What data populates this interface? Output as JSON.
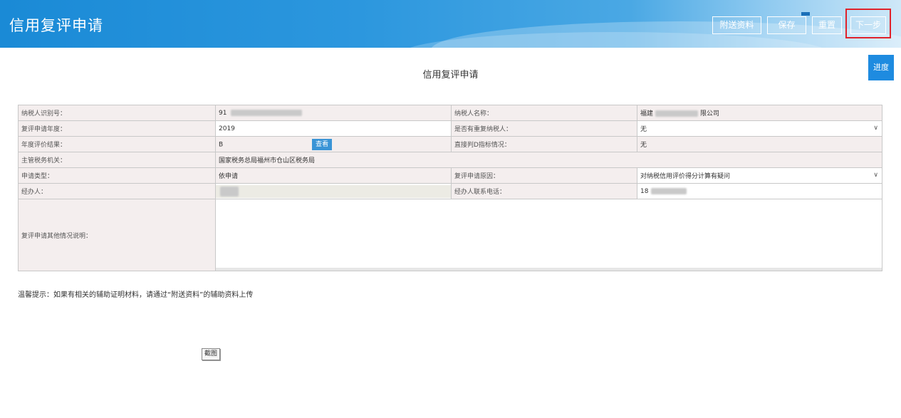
{
  "header": {
    "title": "信用复评申请",
    "buttons": {
      "attach": "附送资料",
      "save": "保存",
      "reset": "重置",
      "next": "下一步"
    }
  },
  "progress_label": "进度",
  "form_title": "信用复评申请",
  "fields": {
    "taxpayer_id_label": "纳税人识别号：",
    "taxpayer_id_value": "91",
    "taxpayer_name_label": "纳税人名称：",
    "taxpayer_name_prefix": "福建",
    "taxpayer_name_suffix": "限公司",
    "year_label": "复评申请年度：",
    "year_value": "2019",
    "duplicate_label": "是否有重复纳税人：",
    "duplicate_value": "无",
    "result_label": "年度评价结果：",
    "result_value": "B",
    "view_button": "查看",
    "direct_d_label": "直接判D指标情况：",
    "direct_d_value": "无",
    "authority_label": "主管税务机关：",
    "authority_value": "国家税务总局福州市仓山区税务局",
    "apply_type_label": "申请类型：",
    "apply_type_value": "依申请",
    "reason_label": "复评申请原因：",
    "reason_value": "对纳税信用评价得分计算有疑问",
    "agent_label": "经办人：",
    "phone_label": "经办人联系电话：",
    "phone_value": "18",
    "other_label": "复评申请其他情况说明："
  },
  "tip": "温馨提示：如果有相关的辅助证明材料，请通过“附送资料”的辅助资料上传",
  "screenshot_button": "截图"
}
